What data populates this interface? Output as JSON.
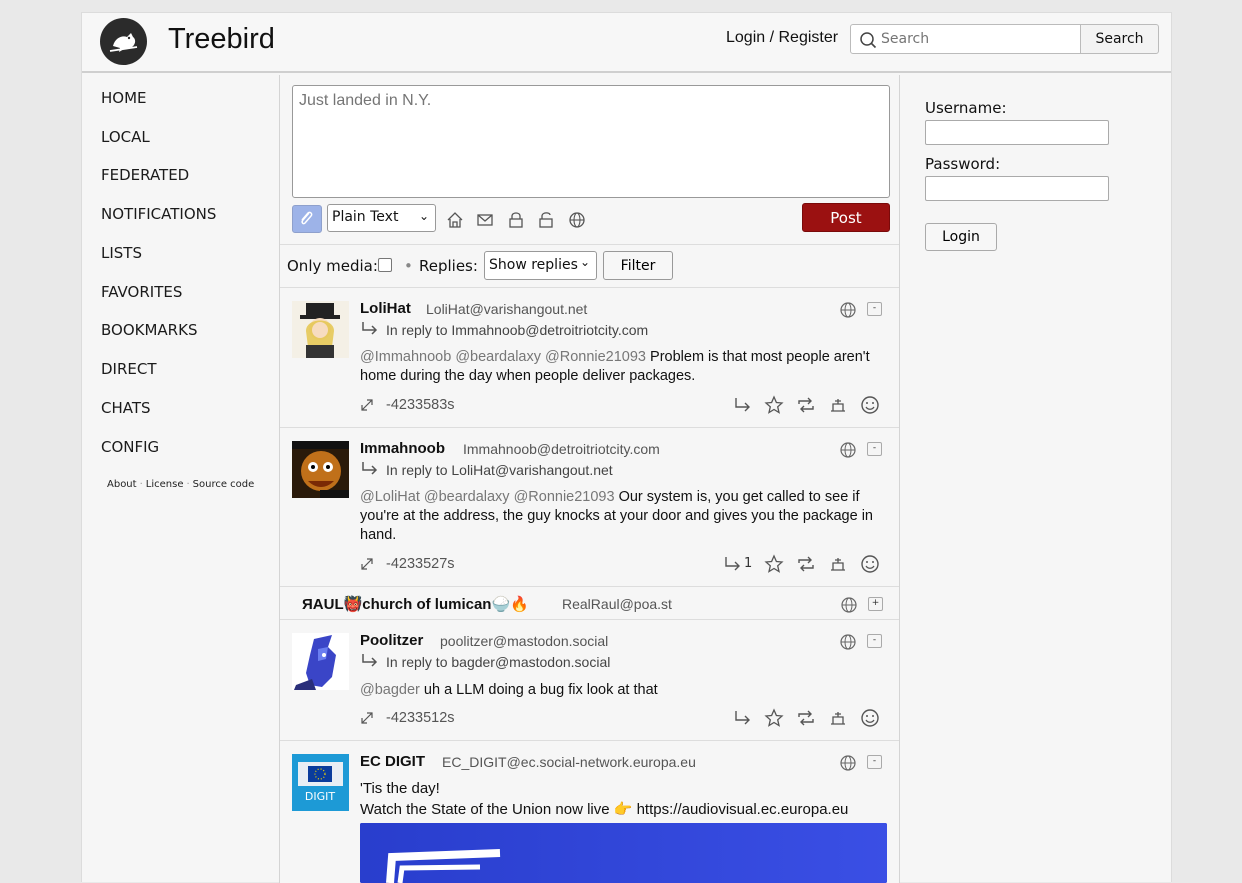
{
  "header": {
    "brand": "Treebird",
    "login_link": "Login / Register",
    "search_placeholder": "Search",
    "search_button": "Search"
  },
  "sidebar": {
    "items": [
      {
        "label": "HOME"
      },
      {
        "label": "LOCAL"
      },
      {
        "label": "FEDERATED"
      },
      {
        "label": "NOTIFICATIONS"
      },
      {
        "label": "LISTS"
      },
      {
        "label": "FAVORITES"
      },
      {
        "label": "BOOKMARKS"
      },
      {
        "label": "DIRECT"
      },
      {
        "label": "CHATS"
      },
      {
        "label": "CONFIG"
      }
    ],
    "footer": {
      "about": "About",
      "license": "License",
      "source": "Source code"
    }
  },
  "compose": {
    "placeholder": "Just landed in N.Y.",
    "content_type": "Plain Text",
    "post_label": "Post"
  },
  "filters": {
    "only_media_label": "Only media:",
    "bullet": "•",
    "replies_label": "Replies:",
    "replies_value": "Show replies",
    "filter_button": "Filter"
  },
  "posts": [
    {
      "name": "LoliHat",
      "handle": "LoliHat@varishangout.net",
      "reply_to": "In reply to Immahnoob@detroitriotcity.com",
      "mentions": "@Immahnoob @beardalaxy @Ronnie21093",
      "text": "Problem is that most people aren't home during the day when people deliver packages.",
      "age": "-4233583s",
      "collapse": "-"
    },
    {
      "name": "Immahnoob",
      "handle": "Immahnoob@detroitriotcity.com",
      "reply_to": "In reply to LoliHat@varishangout.net",
      "mentions": "@LoliHat @beardalaxy @Ronnie21093",
      "text": "Our system is, you get called to see if you're at the address, the guy knocks at your door and gives you the package in hand.",
      "age": "-4233527s",
      "reply_count": "1",
      "collapse": "-"
    },
    {
      "name": "ЯAUL👹church of lumican🍚🔥",
      "handle": "RealRaul@poa.st",
      "collapse": "+"
    },
    {
      "name": "Poolitzer",
      "handle": "poolitzer@mastodon.social",
      "reply_to": "In reply to bagder@mastodon.social",
      "mentions": "@bagder",
      "text": "uh a LLM doing a bug fix look at that",
      "age": "-4233512s",
      "collapse": "-"
    },
    {
      "name": "EC DIGIT",
      "handle": "EC_DIGIT@ec.social-network.europa.eu",
      "line1": "'Tis the day!",
      "line2": "Watch the State of the Union now live 👉 https://audiovisual.ec.europa.eu",
      "avatar_text": "DIGIT",
      "collapse": "-"
    }
  ],
  "login_panel": {
    "username_label": "Username:",
    "password_label": "Password:",
    "login_button": "Login"
  },
  "colors": {
    "post_button": "#9b1111",
    "attach_button": "#9db3e8",
    "mention": "#777777",
    "embed": "#2f45e0"
  }
}
